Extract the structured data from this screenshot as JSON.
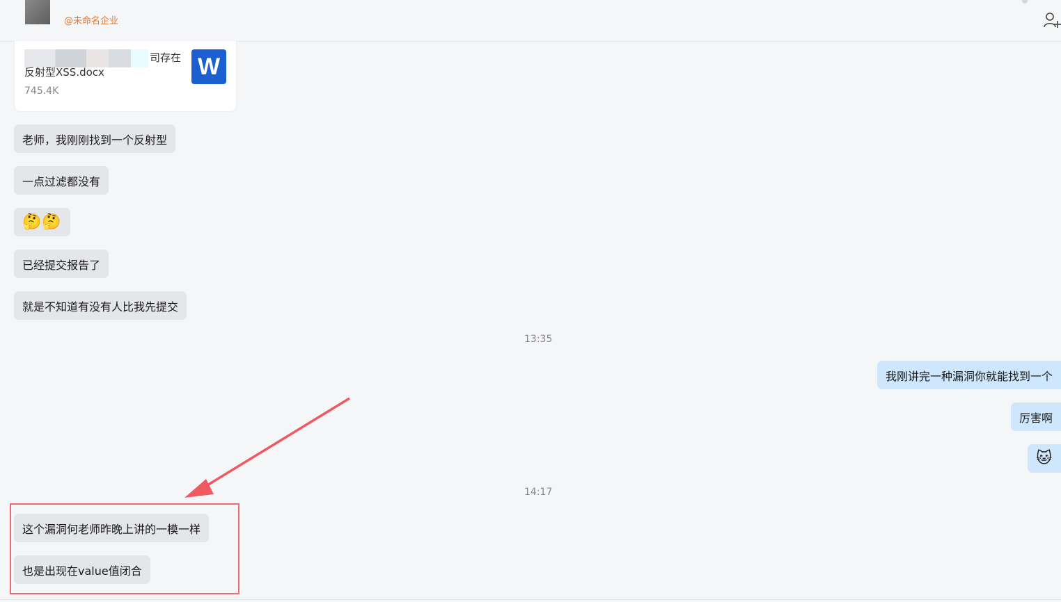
{
  "header": {
    "org_tag": "@未命名企业",
    "add_user_icon": "add-user-icon"
  },
  "file": {
    "name": "司存在反射型XSS.docx",
    "size": "745.4K",
    "type_badge": "W"
  },
  "messages": {
    "m1": "老师，我刚刚找到一个反射型",
    "m2": "一点过滤都没有",
    "m3": "🤔🤔",
    "m4": "已经提交报告了",
    "m5": "就是不知道有没有人比我先提交",
    "time1": "13:35",
    "o1": "我刚讲完一种漏洞你就能找到一个",
    "o2": "厉害啊",
    "o3": "🐱",
    "time2": "14:17",
    "m6": "这个漏洞何老师昨晚上讲的一模一样",
    "m7": "也是出现在value值闭合"
  },
  "colors": {
    "incoming_bubble": "#e4e6e9",
    "outgoing_bubble": "#cfe7fd",
    "annotation": "#ef6b73",
    "org_tag": "#e8772e",
    "word_badge": "#1c5fd1"
  }
}
